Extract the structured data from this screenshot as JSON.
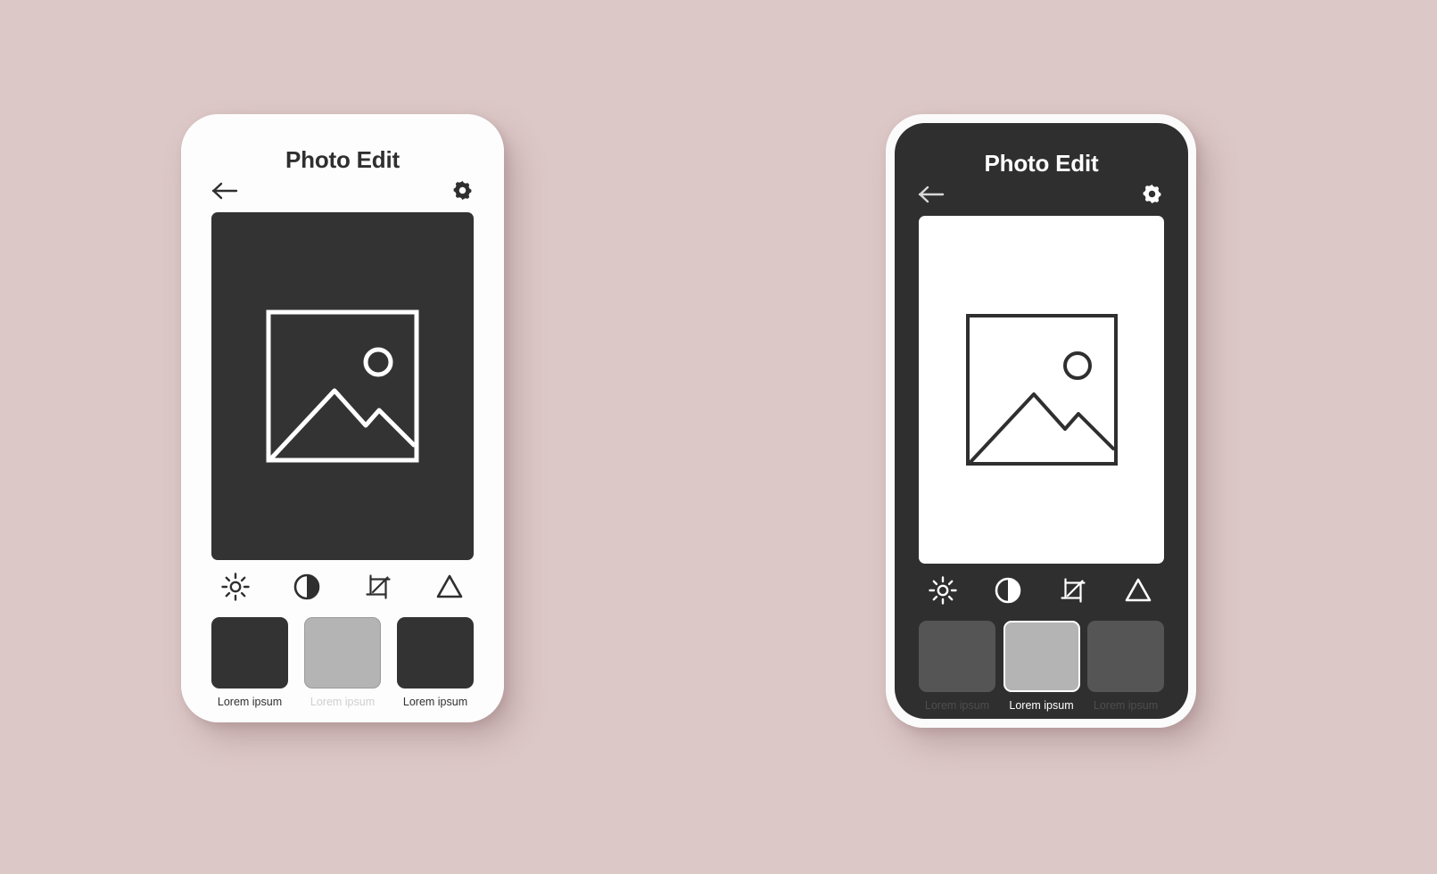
{
  "background_color": "#ddc8c8",
  "screens": [
    {
      "id": "light",
      "theme": "light",
      "title": "Photo Edit",
      "nav": {
        "back_icon": "arrow-left-icon",
        "settings_icon": "gear-icon"
      },
      "canvas": {
        "background_color": "#333333",
        "placeholder_icon": "image-placeholder-icon",
        "stroke_color": "#ffffff"
      },
      "tools": [
        {
          "name": "brightness",
          "icon": "sun-brightness-icon"
        },
        {
          "name": "contrast",
          "icon": "contrast-half-circle-icon"
        },
        {
          "name": "crop",
          "icon": "crop-icon"
        },
        {
          "name": "filter",
          "icon": "triangle-filter-icon"
        }
      ],
      "tool_color": "#2f2f2f",
      "thumbnails": [
        {
          "label": "Lorem ipsum",
          "state": "normal",
          "swatch_color": "#333333"
        },
        {
          "label": "Lorem ipsum",
          "state": "selected",
          "swatch_color": "#b4b4b4"
        },
        {
          "label": "Lorem ipsum",
          "state": "normal",
          "swatch_color": "#333333"
        }
      ]
    },
    {
      "id": "dark",
      "theme": "dark",
      "title": "Photo Edit",
      "nav": {
        "back_icon": "arrow-left-icon",
        "settings_icon": "gear-icon"
      },
      "canvas": {
        "background_color": "#ffffff",
        "placeholder_icon": "image-placeholder-icon",
        "stroke_color": "#2f2f2f"
      },
      "tools": [
        {
          "name": "brightness",
          "icon": "sun-brightness-icon"
        },
        {
          "name": "contrast",
          "icon": "contrast-half-circle-icon"
        },
        {
          "name": "crop",
          "icon": "crop-icon"
        },
        {
          "name": "filter",
          "icon": "triangle-filter-icon"
        }
      ],
      "tool_color": "#ffffff",
      "thumbnails": [
        {
          "label": "Lorem ipsum",
          "state": "normal",
          "swatch_color": "#555555"
        },
        {
          "label": "Lorem ipsum",
          "state": "selected",
          "swatch_color": "#b4b4b4"
        },
        {
          "label": "Lorem ipsum",
          "state": "normal",
          "swatch_color": "#555555"
        }
      ]
    }
  ]
}
